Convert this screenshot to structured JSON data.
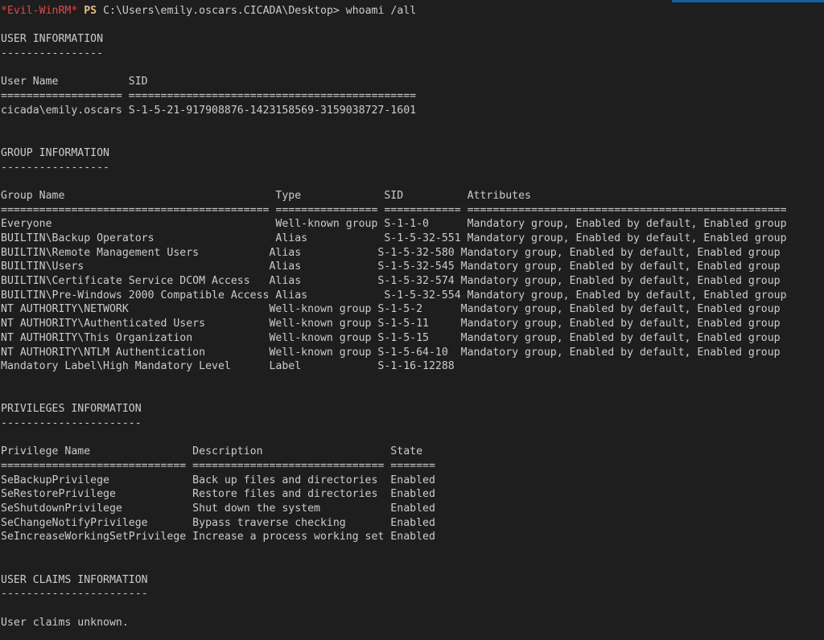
{
  "prompt": {
    "tag": "*Evil-WinRM*",
    "shell": "PS",
    "path": "C:\\Users\\emily.oscars.CICADA\\Desktop>",
    "command": "whoami /all"
  },
  "accent_color": "#0e639c",
  "user_info": {
    "title": "USER INFORMATION",
    "underline": "----------------",
    "header": "User Name           SID",
    "separator": "=================== =============================================",
    "rows": [
      "cicada\\emily.oscars S-1-5-21-917908876-1423158569-3159038727-1601"
    ]
  },
  "group_info": {
    "title": "GROUP INFORMATION",
    "underline": "-----------------",
    "header": "Group Name                                 Type             SID          Attributes",
    "separator": "========================================== ================ ============ ==================================================",
    "rows": [
      "Everyone                                   Well-known group S-1-1-0      Mandatory group, Enabled by default, Enabled group",
      "BUILTIN\\Backup Operators                   Alias            S-1-5-32-551 Mandatory group, Enabled by default, Enabled group",
      "BUILTIN\\Remote Management Users           Alias            S-1-5-32-580 Mandatory group, Enabled by default, Enabled group",
      "BUILTIN\\Users                             Alias            S-1-5-32-545 Mandatory group, Enabled by default, Enabled group",
      "BUILTIN\\Certificate Service DCOM Access   Alias            S-1-5-32-574 Mandatory group, Enabled by default, Enabled group",
      "BUILTIN\\Pre-Windows 2000 Compatible Access Alias            S-1-5-32-554 Mandatory group, Enabled by default, Enabled group",
      "NT AUTHORITY\\NETWORK                      Well-known group S-1-5-2      Mandatory group, Enabled by default, Enabled group",
      "NT AUTHORITY\\Authenticated Users          Well-known group S-1-5-11     Mandatory group, Enabled by default, Enabled group",
      "NT AUTHORITY\\This Organization            Well-known group S-1-5-15     Mandatory group, Enabled by default, Enabled group",
      "NT AUTHORITY\\NTLM Authentication          Well-known group S-1-5-64-10  Mandatory group, Enabled by default, Enabled group",
      "Mandatory Label\\High Mandatory Level      Label            S-1-16-12288"
    ]
  },
  "privileges_info": {
    "title": "PRIVILEGES INFORMATION",
    "underline": "----------------------",
    "header": "Privilege Name                Description                    State",
    "separator": "============================= ============================== =======",
    "rows": [
      "SeBackupPrivilege             Back up files and directories  Enabled",
      "SeRestorePrivilege            Restore files and directories  Enabled",
      "SeShutdownPrivilege           Shut down the system           Enabled",
      "SeChangeNotifyPrivilege       Bypass traverse checking       Enabled",
      "SeIncreaseWorkingSetPrivilege Increase a process working set Enabled"
    ]
  },
  "claims_info": {
    "title": "USER CLAIMS INFORMATION",
    "underline": "-----------------------",
    "message": "User claims unknown."
  }
}
